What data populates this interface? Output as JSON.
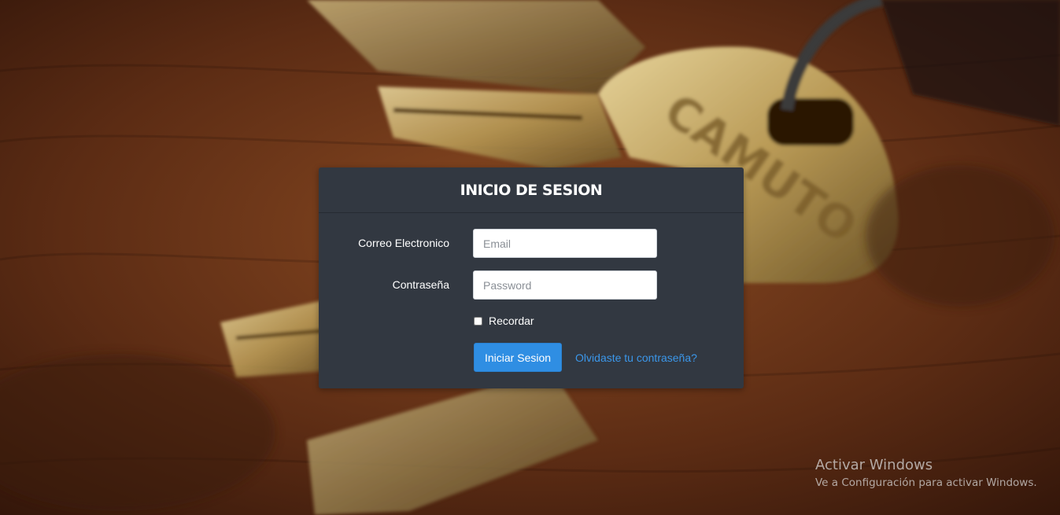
{
  "login": {
    "title": "INICIO DE SESION",
    "email_label": "Correo Electronico",
    "email_placeholder": "Email",
    "email_value": "",
    "password_label": "Contraseña",
    "password_placeholder": "Password",
    "password_value": "",
    "remember_label": "Recordar",
    "remember_checked": false,
    "submit_label": "Iniciar Sesion",
    "forgot_label": "Olvidaste tu contraseña?"
  },
  "watermark": {
    "title": "Activar Windows",
    "subtitle": "Ve a Configuración para activar Windows."
  },
  "colors": {
    "card_bg": "#323841",
    "primary_button": "#2f8ee3",
    "link": "#3b97ea",
    "background": "#4a2414"
  },
  "background": {
    "icon": "keys-photo-background"
  }
}
